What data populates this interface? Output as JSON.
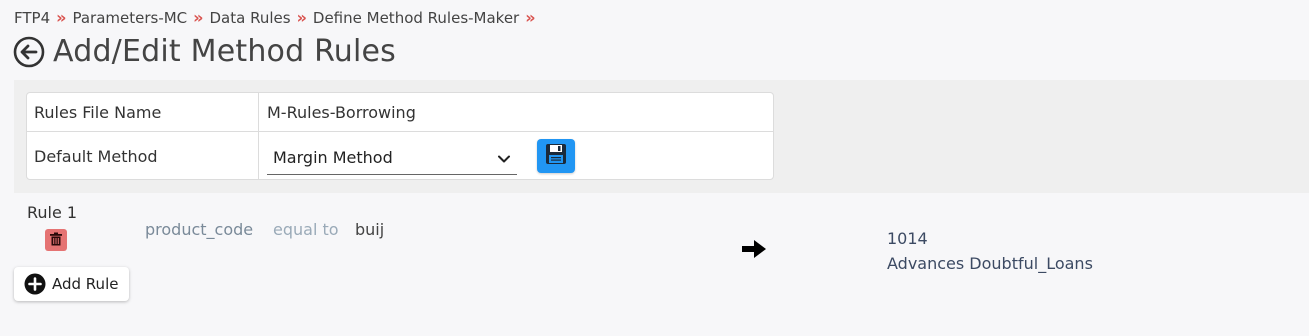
{
  "breadcrumb": {
    "items": [
      "FTP4",
      "Parameters-MC",
      "Data Rules",
      "Define Method Rules-Maker"
    ],
    "separator": "»"
  },
  "header": {
    "title": "Add/Edit Method Rules",
    "back_icon": "back-arrow-circle-icon"
  },
  "form": {
    "rules_file_label": "Rules File Name",
    "rules_file_value": "M-Rules-Borrowing",
    "default_method_label": "Default Method",
    "default_method_value": "Margin Method",
    "save_icon": "floppy-disk-icon"
  },
  "rules": [
    {
      "label": "Rule 1",
      "field": "product_code",
      "operator": "equal to",
      "value": "buij",
      "result_code": "1014",
      "result_name": "Advances Doubtful_Loans"
    }
  ],
  "actions": {
    "add_rule_label": "Add Rule"
  },
  "colors": {
    "accent": "#2196f3",
    "separator": "#d9534f",
    "delete": "#e57373"
  }
}
